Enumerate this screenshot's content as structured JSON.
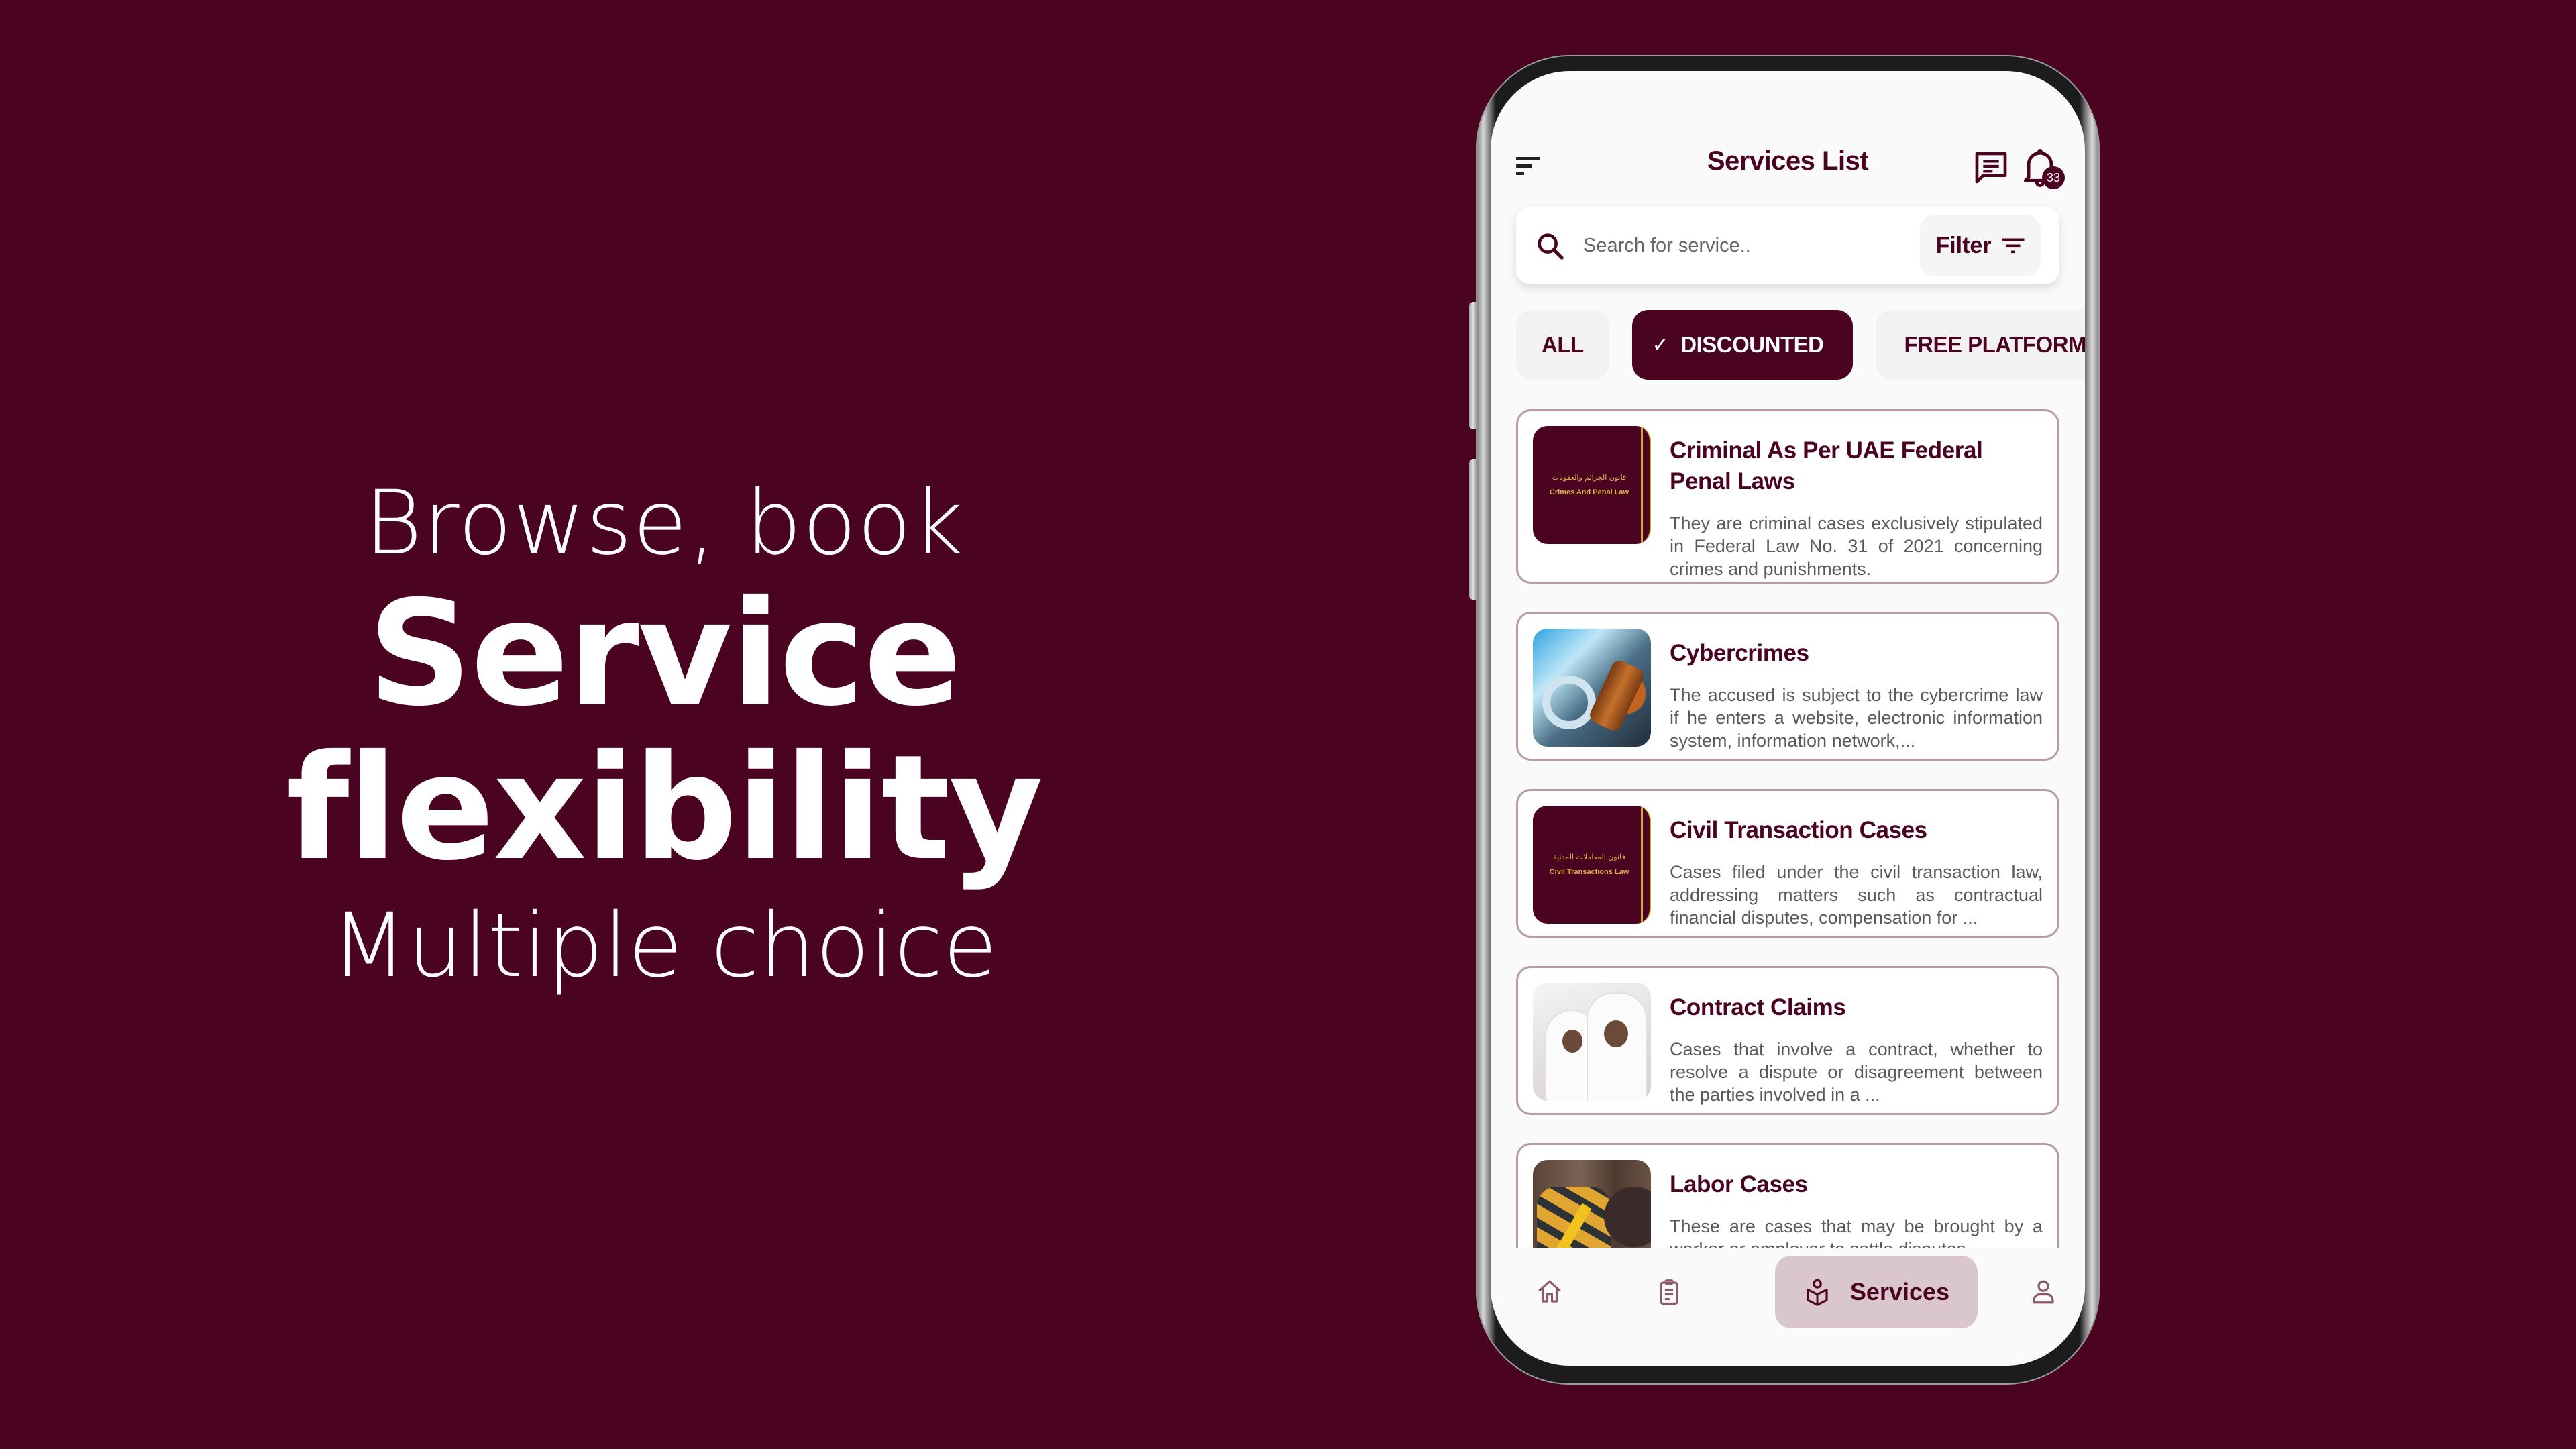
{
  "hero": {
    "line1": "Browse, book",
    "line2": "Service flexibility",
    "line3": "Multiple choice"
  },
  "colors": {
    "brand": "#4a0320",
    "background": "#4a0320",
    "nav_active_bg": "#d9c7cc",
    "card_border": "#b89aa6"
  },
  "appbar": {
    "menu_icon": "sort-menu-icon",
    "title": "Services List",
    "chat_icon": "chat-icon",
    "bell_icon": "bell-icon",
    "notification_count": "33"
  },
  "search": {
    "placeholder": "Search for service..",
    "value": "",
    "filter_label": "Filter",
    "filter_icon": "filter-icon"
  },
  "chips": [
    {
      "label": "ALL",
      "selected": false
    },
    {
      "label": "DISCOUNTED",
      "selected": true,
      "check": "✓"
    },
    {
      "label": "FREE PLATFORM F",
      "selected": false
    }
  ],
  "services": [
    {
      "title": "Criminal As Per UAE Federal Penal Laws",
      "description": "They are criminal cases exclusively stipulated in Federal Law No. 31 of 2021 concerning crimes and punishments.",
      "thumb": {
        "type": "book",
        "arabic": "قانون الجرائم والعقوبات",
        "english": "Crimes And Penal Law"
      }
    },
    {
      "title": "Cybercrimes",
      "description": "The accused is subject to the cybercrime law if he enters a website, electronic information system, information network,...",
      "thumb": {
        "type": "photo",
        "subject": "handcuffs and gavel on keyboard"
      }
    },
    {
      "title": "Civil Transaction Cases",
      "description": "Cases filed under the civil transaction law, addressing matters such as contractual financial disputes, compensation for ...",
      "thumb": {
        "type": "book",
        "arabic": "قانون المعاملات المدنية",
        "english": "Civil Transactions Law"
      }
    },
    {
      "title": "Contract Claims",
      "description": "Cases that involve a contract, whether to resolve a dispute or disagreement between the parties involved in a ...",
      "thumb": {
        "type": "photo",
        "subject": "two men reviewing documents"
      }
    },
    {
      "title": "Labor Cases",
      "description": "These are cases that may be brought by a worker or employer to settle disputes",
      "thumb": {
        "type": "photo",
        "subject": "work gloves, hammer and gavel"
      }
    }
  ],
  "bottom_nav": [
    {
      "name": "home",
      "icon": "home-icon",
      "label": "",
      "active": false
    },
    {
      "name": "orders",
      "icon": "clipboard-icon",
      "label": "",
      "active": false
    },
    {
      "name": "services",
      "icon": "services-reader-icon",
      "label": "Services",
      "active": true
    },
    {
      "name": "profile",
      "icon": "user-icon",
      "label": "",
      "active": false
    }
  ]
}
